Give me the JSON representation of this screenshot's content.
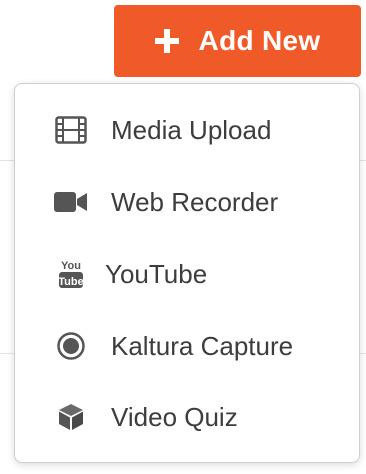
{
  "add_button": {
    "label": "Add New",
    "icon": "plus-icon",
    "color": "#f05a28"
  },
  "menu": {
    "items": [
      {
        "label": "Media Upload",
        "icon": "film-icon"
      },
      {
        "label": "Web Recorder",
        "icon": "video-camera-icon"
      },
      {
        "label": "YouTube",
        "icon": "youtube-icon"
      },
      {
        "label": "Kaltura Capture",
        "icon": "record-icon"
      },
      {
        "label": "Video Quiz",
        "icon": "cube-icon"
      }
    ]
  }
}
